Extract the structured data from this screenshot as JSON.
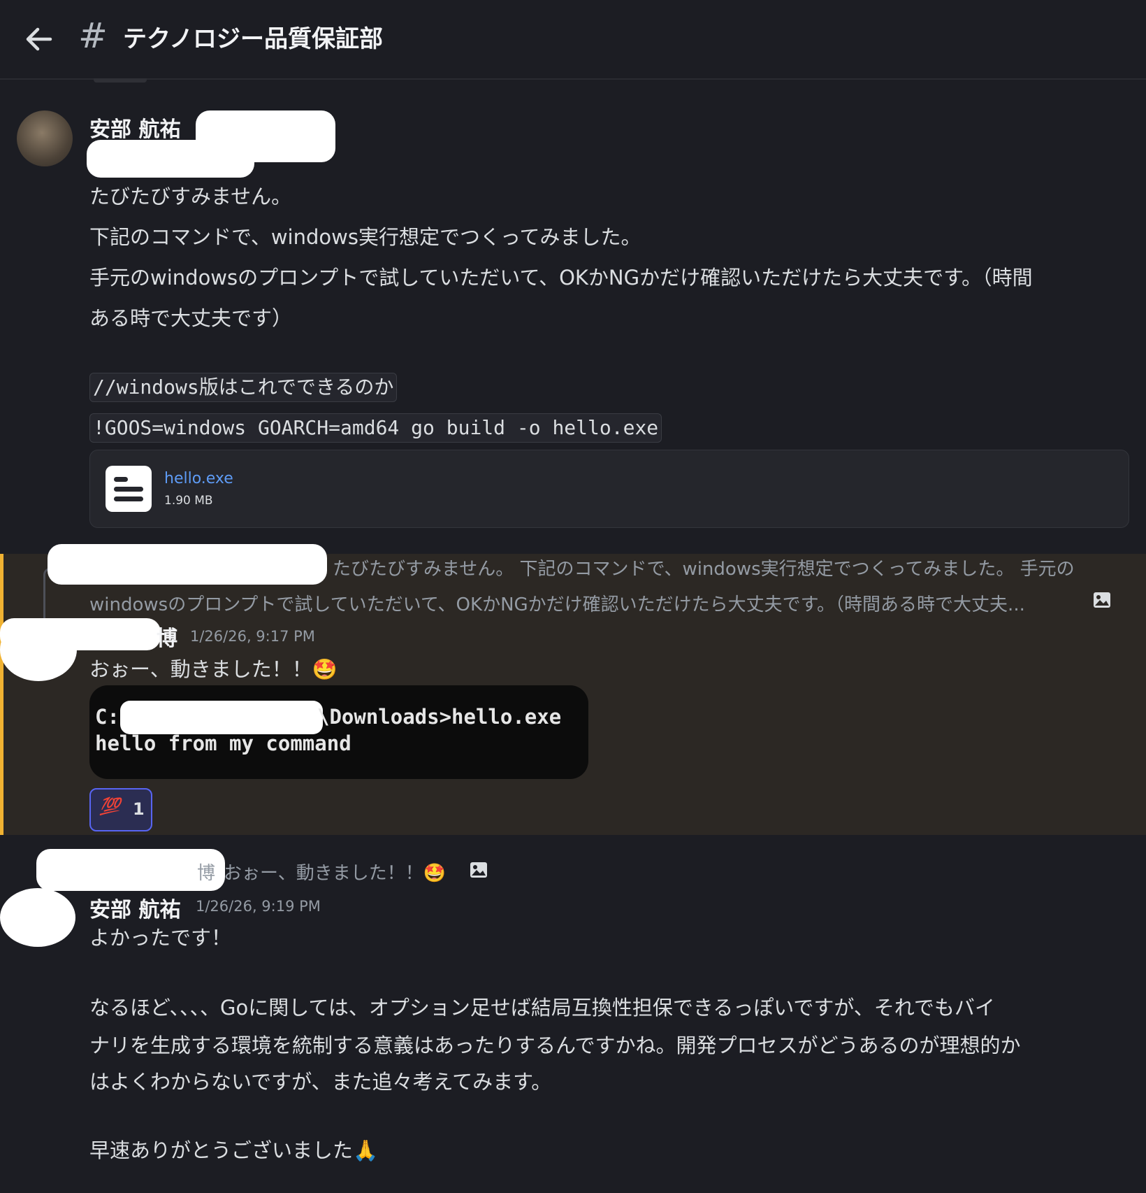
{
  "header": {
    "back_icon": "arrow-left-icon",
    "hash_symbol": "#",
    "channel_name": "テクノロジー品質保証部"
  },
  "message1": {
    "author": "安部 航祐",
    "lines": [
      "たびたびすみません。",
      "下記のコマンドで、windows実行想定でつくってみました。",
      "手元のwindowsのプロンプトで試していただいて、OKかNGかだけ確認いただけたら大丈夫です。（時間",
      "ある時で大丈夫です）"
    ],
    "code_lines": [
      "//windows版はこれでできるのか",
      "!GOOS=windows GOARCH=amd64 go build -o hello.exe"
    ],
    "attachment": {
      "icon": "file-document-icon",
      "file_name": "hello.exe",
      "file_size": "1.90 MB"
    }
  },
  "message2": {
    "reply_preview_line1": "たびたびすみません。 下記のコマンドで、windows実行想定でつくってみました。 手元の",
    "reply_preview_line2": "windowsのプロンプトで試していただいて、OKかNGかだけ確認いただけたら大丈夫です。（時間ある時で大丈夫...",
    "author_partial": "博",
    "timestamp": "1/26/26, 9:17 PM",
    "text": "おぉー、動きました！！🤩",
    "terminal": {
      "line1_prefix": "C:",
      "line1_suffix": "\\Downloads>hello.exe",
      "line2": "hello from my command"
    },
    "reaction": {
      "emoji": "💯",
      "count": "1"
    }
  },
  "message3": {
    "reply_preview_author_partial": "博",
    "reply_preview_text": "おぉー、動きました！！🤩",
    "author": "安部 航祐",
    "timestamp": "1/26/26, 9:19 PM",
    "lines": [
      "よかったです！",
      "なるほど、、、、Goに関しては、オプション足せば結局互換性担保できるっぽいですが、それでもバイ",
      "ナリを生成する環境を統制する意義はあったりするんですかね。開発プロセスがどうあるのが理想的か",
      "はよくわからないですが、また追々考えてみます。",
      "早速ありがとうございました🙏"
    ]
  },
  "colors": {
    "background": "#1c1d23",
    "highlight_background": "#2c2824",
    "highlight_bar": "#f0b232",
    "link": "#5e9bf5",
    "reaction_border": "#5865f2"
  }
}
